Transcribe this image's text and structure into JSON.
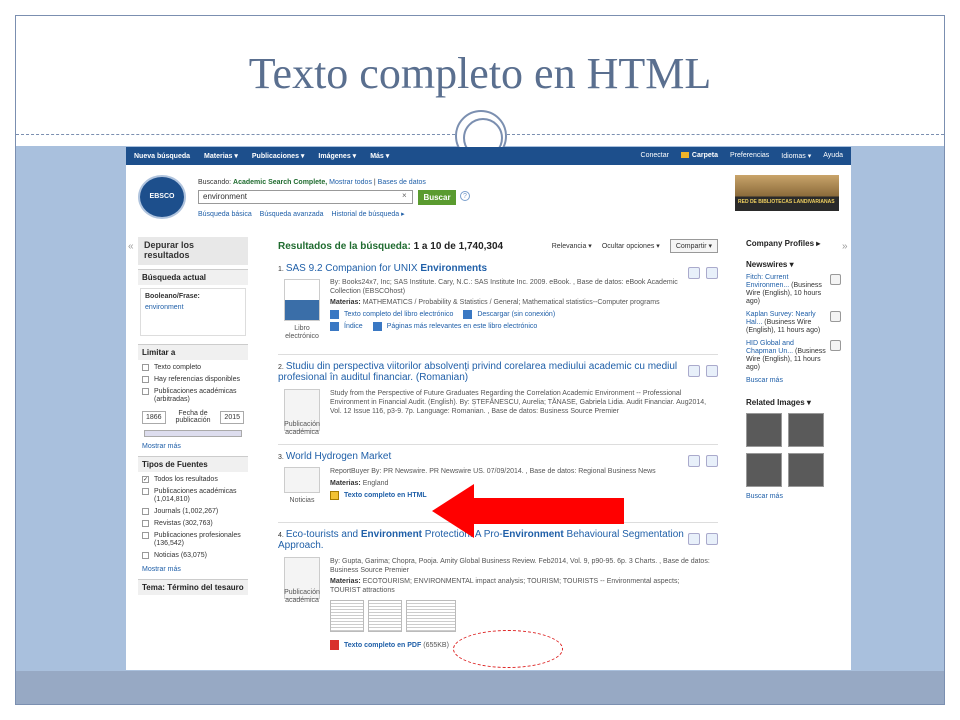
{
  "slide": {
    "title": "Texto completo en HTML"
  },
  "nav": {
    "left": [
      "Nueva búsqueda",
      "Materias ▾",
      "Publicaciones ▾",
      "Imágenes ▾",
      "Más ▾"
    ],
    "right": [
      "Conectar",
      "Carpeta",
      "Preferencias",
      "Idiomas ▾",
      "Ayuda"
    ]
  },
  "search": {
    "logo_text": "EBSCO",
    "buscando_prefix": "Buscando:",
    "database": "Academic Search Complete,",
    "show_all": "Mostrar todos",
    "db_link": "Bases de datos",
    "query": "environment",
    "clear": "×",
    "button": "Buscar",
    "help": "?",
    "links": [
      "Búsqueda básica",
      "Búsqueda avanzada",
      "Historial de búsqueda ▸"
    ],
    "banner": "RED DE BIBLIOTECAS LANDIVARIANAS"
  },
  "left": {
    "depurar": "Depurar los resultados",
    "busqueda_actual": "Búsqueda actual",
    "boolean_label": "Booleano/Frase:",
    "boolean_value": "environment",
    "limitar": "Limitar a",
    "limits": [
      "Texto completo",
      "Hay referencias disponibles",
      "Publicaciones académicas (arbitradas)"
    ],
    "year_from": "1866",
    "fecha_label": "Fecha de publicación",
    "year_to": "2015",
    "mostrar_mas": "Mostrar más",
    "tipos": "Tipos de Fuentes",
    "sources": [
      {
        "label": "Todos los resultados",
        "checked": true
      },
      {
        "label": "Publicaciones académicas (1,014,810)",
        "checked": false
      },
      {
        "label": "Journals (1,002,267)",
        "checked": false
      },
      {
        "label": "Revistas (302,763)",
        "checked": false
      },
      {
        "label": "Publicaciones profesionales (136,542)",
        "checked": false
      },
      {
        "label": "Noticias (63,075)",
        "checked": false
      }
    ],
    "mostrar_mas2": "Mostrar más",
    "tema": "Tema: Término del tesauro"
  },
  "results_header": {
    "label": "Resultados de la búsqueda:",
    "range": "1 a 10 de 1,740,304",
    "relevancia": "Relevancia ▾",
    "ocultar": "Ocultar opciones ▾",
    "compartir": "Compartir ▾"
  },
  "results": [
    {
      "num": "1.",
      "title_a": "SAS 9.2 Companion for UNIX ",
      "title_b": "Environments",
      "title_c": "",
      "meta1": "By: Books24x7, Inc; SAS Institute. Cary, N.C.: SAS Institute Inc. 2009. eBook. , Base de datos: eBook Academic Collection (EBSCOhost)",
      "materias_label": "Materias:",
      "materias": "MATHEMATICS / Probability & Statistics / General; Mathematical statistics--Computer programs",
      "link1": "Texto completo del libro electrónico",
      "link2": "Descargar (sin conexión)",
      "link3": "Índice",
      "link4": "Páginas más relevantes en este libro electrónico",
      "type": "Libro electrónico"
    },
    {
      "num": "2.",
      "title": "Studiu din perspectiva viitorilor absolvenți privind corelarea mediului academic cu mediul profesional în auditul financiar. (Romanian)",
      "meta1": "Study from the Perspective of Future Graduates Regarding the Correlation Academic Environment -- Professional Environment in Financial Audit. (English). By: ȘTEFĂNESCU, Aurelia; TĂNASE, Gabriela Lidia. Audit Financiar. Aug2014, Vol. 12 Issue 116, p3-9. 7p. Language: Romanian. , Base de datos: Business Source Premier",
      "type": "Publicación académica"
    },
    {
      "num": "3.",
      "title": "World Hydrogen Market",
      "meta1": "ReportBuyer By: PR Newswire. PR Newswire US. 07/09/2014. , Base de datos: Regional Business News",
      "materias_label": "Materias:",
      "materias": "England",
      "link1": "Texto completo en HTML",
      "type": "Noticias"
    },
    {
      "num": "4.",
      "title_a": "Eco-tourists and ",
      "title_b": "Environment",
      "title_c": " Protection: A Pro-",
      "title_d": "Environment",
      "title_e": " Behavioural Segmentation Approach.",
      "meta1": "By: Gupta, Garima; Chopra, Pooja. Amity Global Business Review. Feb2014, Vol. 9, p90-95. 6p. 3 Charts. , Base de datos: Business Source Premier",
      "materias_label": "Materias:",
      "materias": "ECOTOURISM; ENVIRONMENTAL impact analysis; TOURISM; TOURISTS -- Environmental aspects; TOURIST attractions",
      "link1": "Texto completo en PDF",
      "pdf_size": "(655KB)",
      "type": "Publicación académica"
    }
  ],
  "right": {
    "company": "Company Profiles ▸",
    "newswires": "Newswires ▾",
    "news": [
      {
        "link": "Fitch: Current Environmen...",
        "rest": " (Business Wire (English), 10 hours ago)"
      },
      {
        "link": "Kaplan Survey: Nearly Hal...",
        "rest": " (Business Wire (English), 11 hours ago)"
      },
      {
        "link": "HID Global and Chapman Un...",
        "rest": " (Business Wire (English), 11 hours ago)"
      }
    ],
    "buscar_mas": "Buscar más",
    "related": "Related Images ▾",
    "buscar_mas2": "Buscar más"
  },
  "colors": {
    "arrow": "#ff0000",
    "nav": "#1d4f8c"
  }
}
